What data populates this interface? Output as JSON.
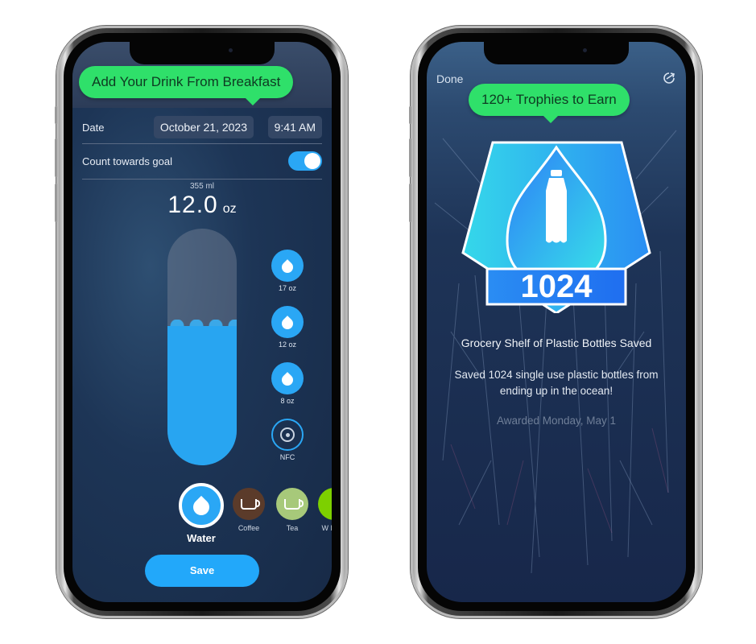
{
  "left_screen": {
    "callout": "Add Your Drink From Breakfast",
    "date_label": "Date",
    "date_value": "October 21, 2023",
    "time_value": "9:41 AM",
    "goal_label": "Count towards goal",
    "goal_toggle_on": true,
    "volume_ml": "355 ml",
    "volume_oz": "12.0",
    "volume_unit": "oz",
    "fill_fraction": 0.59,
    "presets": [
      {
        "label": "17 oz",
        "icon": "water-drop-icon"
      },
      {
        "label": "12 oz",
        "icon": "water-drop-icon"
      },
      {
        "label": "8 oz",
        "icon": "water-drop-icon"
      },
      {
        "label": "NFC",
        "icon": "nfc-icon"
      }
    ],
    "drinks": [
      {
        "label": "Water",
        "icon": "water-drop-icon",
        "color": "#2aa7f5",
        "selected": true
      },
      {
        "label": "Coffee",
        "icon": "coffee-cup-icon",
        "color": "#5b3b2a"
      },
      {
        "label": "Tea",
        "icon": "tea-cup-icon",
        "color": "#a7c97a"
      },
      {
        "label": "W Elect",
        "icon": "electrolyte-icon",
        "color": "#7dd000"
      }
    ],
    "save_label": "Save",
    "accent": "#22a8fa",
    "callout_color": "#2fe06a"
  },
  "right_screen": {
    "done_label": "Done",
    "share_icon": "share-icon",
    "callout": "120+ Trophies to Earn",
    "badge_number": "1024",
    "badge_icon": "plastic-bottle-icon",
    "title": "Grocery Shelf of Plastic Bottles Saved",
    "description": "Saved 1024 single use plastic bottles from ending up in the ocean!",
    "awarded": "Awarded Monday, May 1"
  }
}
